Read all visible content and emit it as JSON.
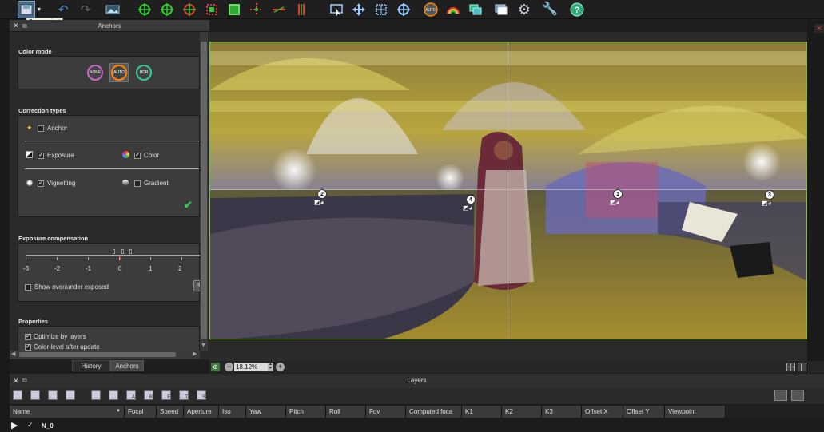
{
  "tooltip": "Save project",
  "panel": {
    "title": "Anchors",
    "color_mode": {
      "title": "Color mode",
      "buttons": [
        "NONE",
        "AUTO",
        "HDR"
      ]
    },
    "correction_types": {
      "title": "Correction types",
      "anchor": "Anchor",
      "exposure": "Exposure",
      "color": "Color",
      "vignetting": "Vignetting",
      "gradient": "Gradient"
    },
    "exposure_compensation": {
      "title": "Exposure compensation",
      "ticks": [
        "-3",
        "-2",
        "-1",
        "0",
        "1",
        "2"
      ],
      "show_over_under": "Show over/under exposed",
      "r_button": "R"
    },
    "properties": {
      "title": "Properties",
      "optimize": "Optimize by layers",
      "color_level": "Color level after update"
    },
    "tabs": [
      "History",
      "Anchors"
    ]
  },
  "viewer": {
    "anchors": [
      "1",
      "2",
      "3",
      "4"
    ]
  },
  "status": {
    "zoom": "18.12%"
  },
  "layers": {
    "title": "Layers",
    "tool_letters": [
      "A",
      "B",
      "F",
      "T",
      "S"
    ],
    "columns": [
      "Name",
      "Focal",
      "Speed",
      "Aperture",
      "Iso",
      "Yaw",
      "Pitch",
      "Roll",
      "Fov",
      "Computed foca",
      "K1",
      "K2",
      "K3",
      "Offset X",
      "Offset Y",
      "Viewpoint"
    ],
    "row0_name": "N_0"
  },
  "colors": {
    "accent_green": "#34c759",
    "viewer_border": "#7ec23c"
  }
}
